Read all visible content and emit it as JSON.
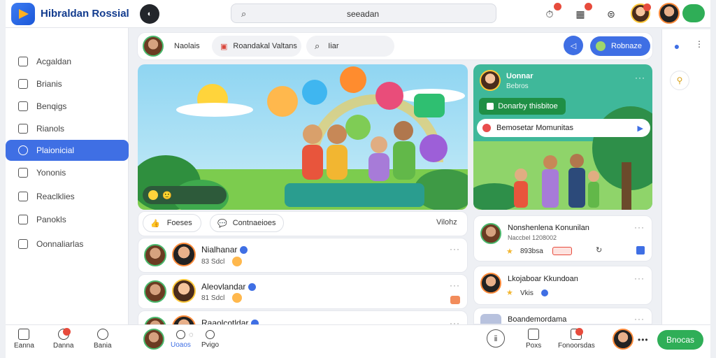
{
  "app": {
    "title": "Hibraldan Rossial"
  },
  "search": {
    "placeholder": "seeadan"
  },
  "header": {
    "action_label": ""
  },
  "sidebar": {
    "items": [
      {
        "label": "Acgaldan"
      },
      {
        "label": "Brianis"
      },
      {
        "label": "Benqigs"
      },
      {
        "label": "Rianols"
      },
      {
        "label": "Plaionicial"
      },
      {
        "label": "Yononis"
      },
      {
        "label": "Reaclklies"
      },
      {
        "label": "Panokls"
      },
      {
        "label": "Oonnaliarlas"
      }
    ]
  },
  "toolbar": {
    "user_label": "Naolais",
    "chip1": "Roandakal Valtans",
    "chip2": "Iiar",
    "action_label": "Robnaze"
  },
  "post": {
    "action1": "Foeses",
    "action2": "Contnaeioes",
    "action3": "Vilohz"
  },
  "comments": [
    {
      "name": "Nialhanar",
      "meta": "83 Sdcl"
    },
    {
      "name": "Aleovlandar",
      "meta": "81 Sdcl"
    },
    {
      "name": "Raaolcotldar",
      "meta": ""
    }
  ],
  "right_card": {
    "name": "Uonnar",
    "sub": "Bebros",
    "green_label": "Donarby thisbitoe",
    "message": "Bemosetar Momunitas"
  },
  "right_list": [
    {
      "title": "Nonshenlena Konunilan",
      "sub": "Naccbel 1208002",
      "count": "893bsa"
    },
    {
      "title": "Lkojaboar Kkundoan",
      "sub": "Vkis"
    },
    {
      "title": "Boandemordama",
      "sub": ""
    }
  ],
  "bottom": {
    "items": [
      {
        "label": "Eanna"
      },
      {
        "label": "Danna"
      },
      {
        "label": "Bania"
      }
    ],
    "tabs": [
      {
        "label": "Uoaos"
      },
      {
        "label": "Pvigo"
      }
    ],
    "right_items": [
      {
        "label": ""
      },
      {
        "label": "Poxs"
      },
      {
        "label": "Fonoorsdas"
      }
    ],
    "cta": "Bnocas"
  },
  "colors": {
    "accent": "#3f6fe4",
    "green": "#2fae57",
    "badge": "#e74b3c"
  }
}
